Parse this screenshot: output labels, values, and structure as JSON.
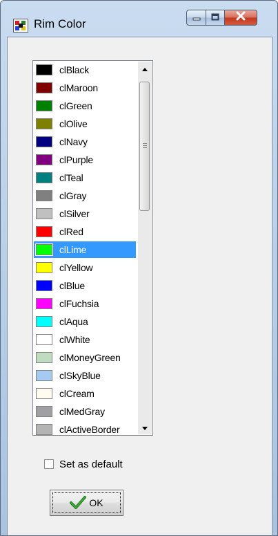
{
  "window": {
    "title": "Rim Color"
  },
  "list": {
    "selected_index": 10,
    "items": [
      {
        "label": "clBlack",
        "color": "#000000"
      },
      {
        "label": "clMaroon",
        "color": "#800000"
      },
      {
        "label": "clGreen",
        "color": "#008000"
      },
      {
        "label": "clOlive",
        "color": "#808000"
      },
      {
        "label": "clNavy",
        "color": "#000080"
      },
      {
        "label": "clPurple",
        "color": "#800080"
      },
      {
        "label": "clTeal",
        "color": "#008080"
      },
      {
        "label": "clGray",
        "color": "#808080"
      },
      {
        "label": "clSilver",
        "color": "#c0c0c0"
      },
      {
        "label": "clRed",
        "color": "#ff0000"
      },
      {
        "label": "clLime",
        "color": "#00ff00"
      },
      {
        "label": "clYellow",
        "color": "#ffff00"
      },
      {
        "label": "clBlue",
        "color": "#0000ff"
      },
      {
        "label": "clFuchsia",
        "color": "#ff00ff"
      },
      {
        "label": "clAqua",
        "color": "#00ffff"
      },
      {
        "label": "clWhite",
        "color": "#ffffff"
      },
      {
        "label": "clMoneyGreen",
        "color": "#c0dcc0"
      },
      {
        "label": "clSkyBlue",
        "color": "#a6caf0"
      },
      {
        "label": "clCream",
        "color": "#fffbf0"
      },
      {
        "label": "clMedGray",
        "color": "#a0a0a4"
      },
      {
        "label": "clActiveBorder",
        "color": "#b4b4b4"
      }
    ]
  },
  "checkbox": {
    "label": "Set as default",
    "checked": false
  },
  "ok_button": {
    "label": "OK"
  },
  "colors": {
    "selection": "#3399ff",
    "close_button": "#c2381f"
  },
  "icons": {
    "app": "color-dialog-icon",
    "minimize": "minimize-icon",
    "maximize": "maximize-icon",
    "close": "close-icon",
    "ok": "checkmark-icon"
  }
}
